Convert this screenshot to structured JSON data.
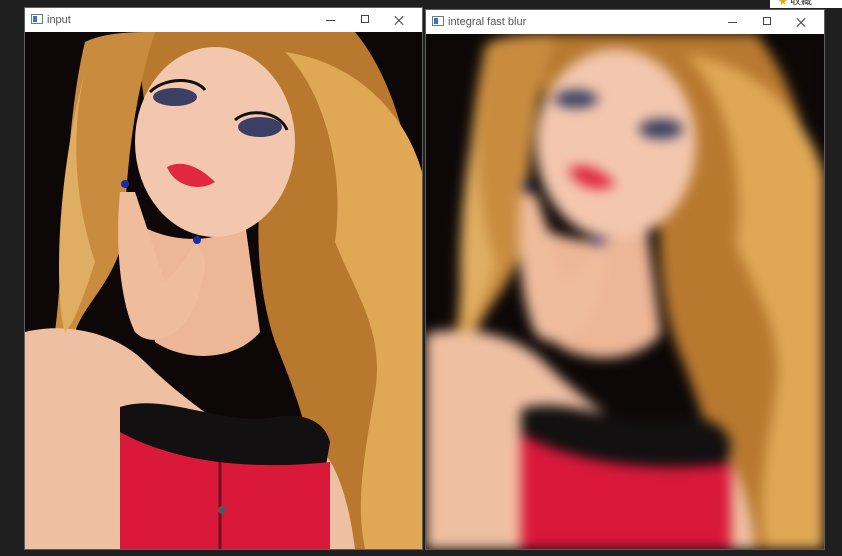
{
  "windows": [
    {
      "title": "input",
      "image": "portrait-photo"
    },
    {
      "title": "integral fast blur",
      "image": "portrait-photo-blurred"
    }
  ],
  "controls": {
    "minimize_icon": "minimize-icon",
    "maximize_icon": "maximize-icon",
    "close_icon": "close-icon"
  },
  "corner_snippet": {
    "icon": "star-icon",
    "text": "收藏"
  },
  "colors": {
    "titlebar": "#ffffff",
    "image_background": "#0d0807",
    "hair": "#d9a24f",
    "skin": "#f1c0a4",
    "corset": "#d9183a",
    "lace": "#111111",
    "lips": "#e2283f",
    "nails": "#1b2aa8"
  }
}
